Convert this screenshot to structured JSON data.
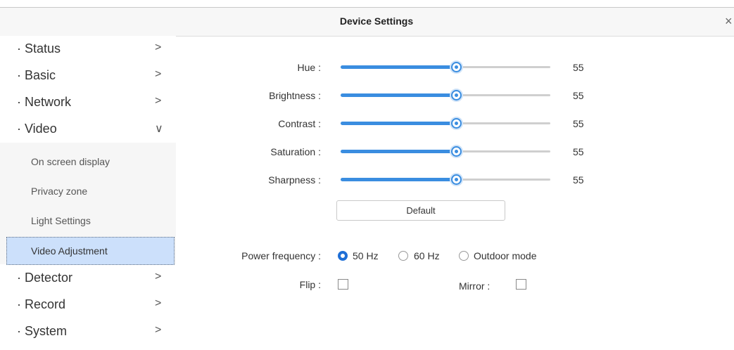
{
  "window": {
    "title": "Device Settings",
    "close_glyph": "×"
  },
  "sidebar": {
    "items": [
      {
        "label": "· Status",
        "chevron": ">"
      },
      {
        "label": "· Basic",
        "chevron": ">"
      },
      {
        "label": "· Network",
        "chevron": ">"
      },
      {
        "label": "· Video",
        "chevron": "∨"
      },
      {
        "label": "· Detector",
        "chevron": ">"
      },
      {
        "label": "· Record",
        "chevron": ">"
      },
      {
        "label": "· System",
        "chevron": ">"
      }
    ],
    "video_submenu": [
      {
        "label": "On screen display"
      },
      {
        "label": "Privacy zone"
      },
      {
        "label": "Light Settings"
      },
      {
        "label": "Video Adjustment",
        "active": true
      }
    ]
  },
  "adjustments": [
    {
      "label": "Hue :",
      "value": 55
    },
    {
      "label": "Brightness :",
      "value": 55
    },
    {
      "label": "Contrast :",
      "value": 55
    },
    {
      "label": "Saturation :",
      "value": 55
    },
    {
      "label": "Sharpness :",
      "value": 55
    }
  ],
  "slider_range": [
    0,
    100
  ],
  "default_button": "Default",
  "power_frequency": {
    "label": "Power frequency :",
    "options": [
      "50 Hz",
      "60 Hz",
      "Outdoor mode"
    ],
    "selected": "50 Hz"
  },
  "flip": {
    "label": "Flip :",
    "checked": false
  },
  "mirror": {
    "label": "Mirror :",
    "checked": false
  },
  "colors": {
    "accent": "#3a8de0",
    "active_bg": "#cce0fb"
  }
}
